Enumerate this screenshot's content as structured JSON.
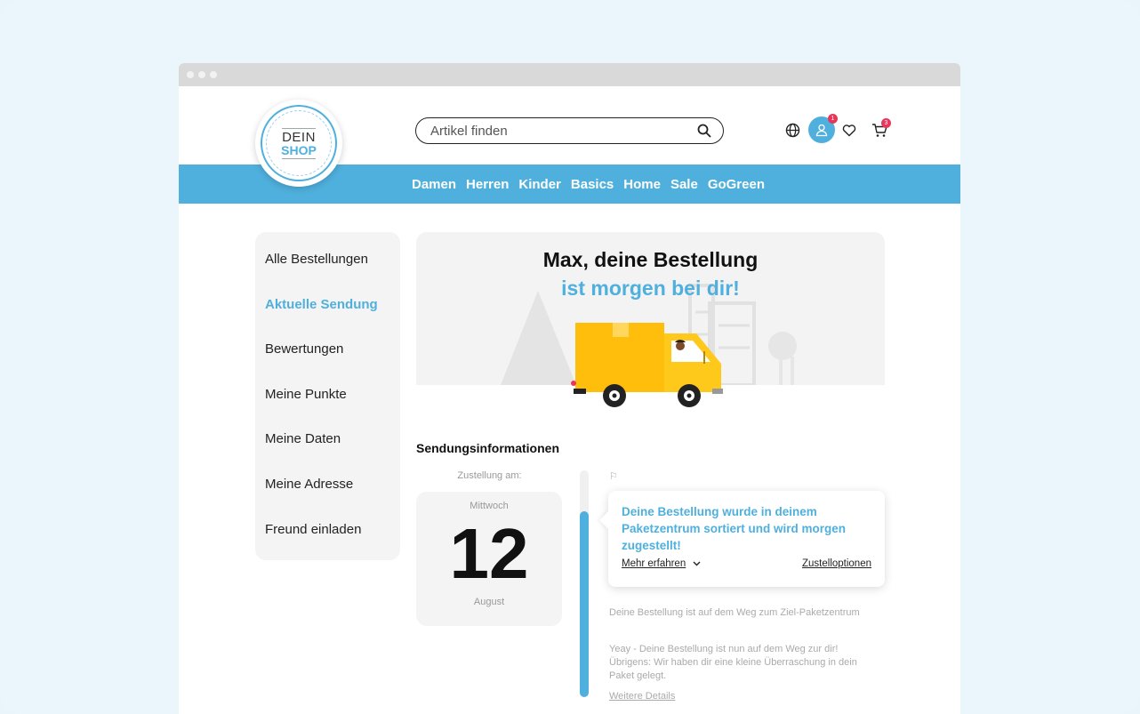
{
  "logo": {
    "line1": "DEIN",
    "line2": "SHOP"
  },
  "search": {
    "placeholder": "Artikel finden"
  },
  "header_icons": {
    "user_badge": "1",
    "cart_badge": "3"
  },
  "nav": [
    "Damen",
    "Herren",
    "Kinder",
    "Basics",
    "Home",
    "Sale",
    "GoGreen"
  ],
  "sidebar": {
    "items": [
      {
        "label": "Alle Bestellungen",
        "active": false
      },
      {
        "label": "Aktuelle Sendung",
        "active": true
      },
      {
        "label": "Bewertungen",
        "active": false
      },
      {
        "label": "Meine Punkte",
        "active": false
      },
      {
        "label": "Meine Daten",
        "active": false
      },
      {
        "label": "Meine Adresse",
        "active": false
      },
      {
        "label": "Freund einladen",
        "active": false
      }
    ]
  },
  "hero": {
    "title": "Max, deine Bestellung",
    "subtitle": "ist morgen bei dir!"
  },
  "shipment": {
    "section_title": "Sendungsinformationen",
    "delivery_label": "Zustellung am:",
    "weekday": "Mittwoch",
    "day": "12",
    "month": "August",
    "progress": 0.82,
    "current_status": "Deine Bestellung wurde in deinem Paketzentrum sortiert und wird morgen zugestellt!",
    "more_label": "Mehr erfahren",
    "options_label": "Zustelloptionen",
    "message1": "Deine Bestellung ist auf dem Weg zum Ziel-Paketzentrum",
    "message2": "Yeay - Deine Bestellung ist nun auf dem Weg zur dir! Übrigens: Wir haben dir eine kleine Überraschung in dein Paket gelegt.",
    "details_label": "Weitere Details"
  },
  "colors": {
    "accent": "#4fb0dd",
    "badge": "#e8365b",
    "truck": "#ffc20e"
  }
}
